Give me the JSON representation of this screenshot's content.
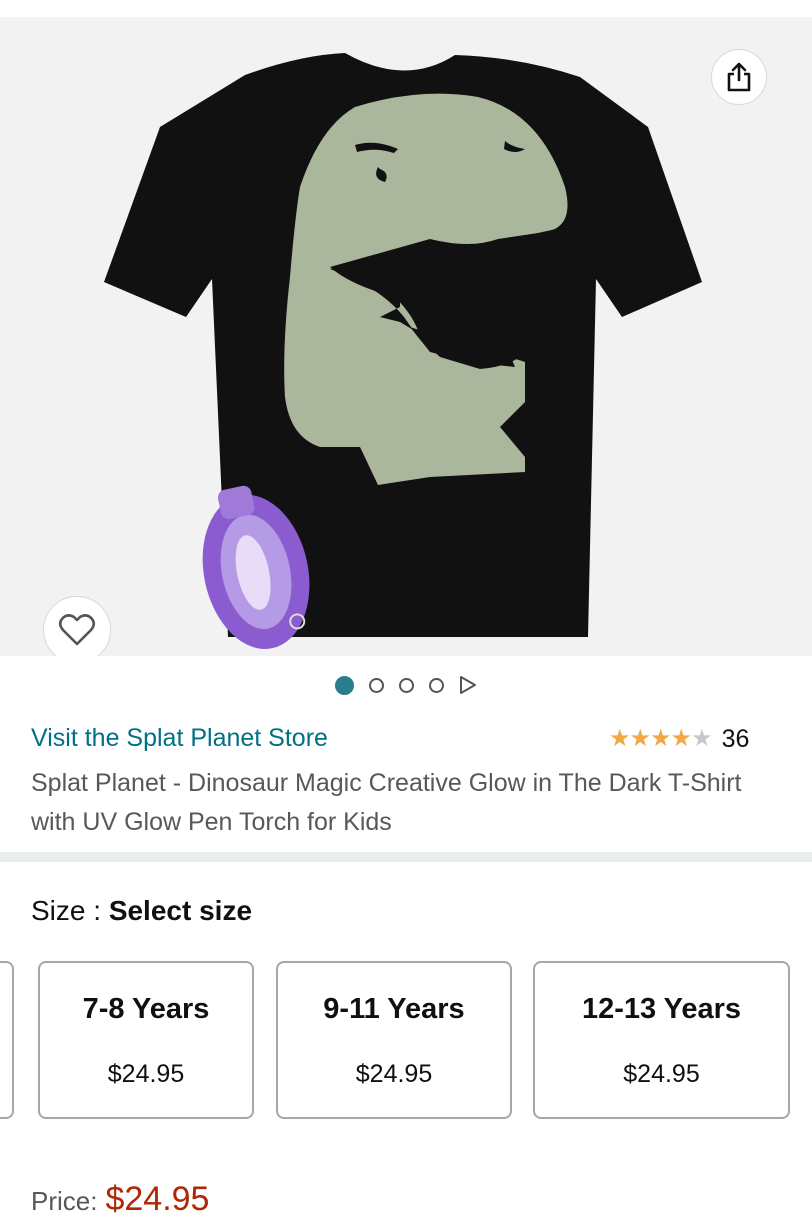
{
  "gallery": {
    "image_alt": "Black T-shirt with glow-in-the-dark dinosaur head print and purple UV pen torch",
    "share_icon": "share-icon",
    "wishlist_icon": "heart-icon",
    "indicator_count": 4,
    "active_index": 0
  },
  "product": {
    "store_link": "Visit the Splat Planet Store",
    "rating_stars": 4.5,
    "rating_count": "36",
    "title": "Splat Planet - Dinosaur Magic Creative Glow in The Dark T-Shirt with UV Glow Pen Torch for Kids"
  },
  "size": {
    "label": "Size : ",
    "selected": "Select size",
    "options": [
      {
        "name": "7-8 Years",
        "price": "$24.95"
      },
      {
        "name": "9-11 Years",
        "price": "$24.95"
      },
      {
        "name": "12-13 Years",
        "price": "$24.95"
      }
    ]
  },
  "price": {
    "label": "Price:",
    "amount": "$24.95"
  },
  "colors": {
    "link": "#007185",
    "star": "#f3a847",
    "price_red": "#b12704",
    "indicator_active": "#2a7d8c"
  }
}
